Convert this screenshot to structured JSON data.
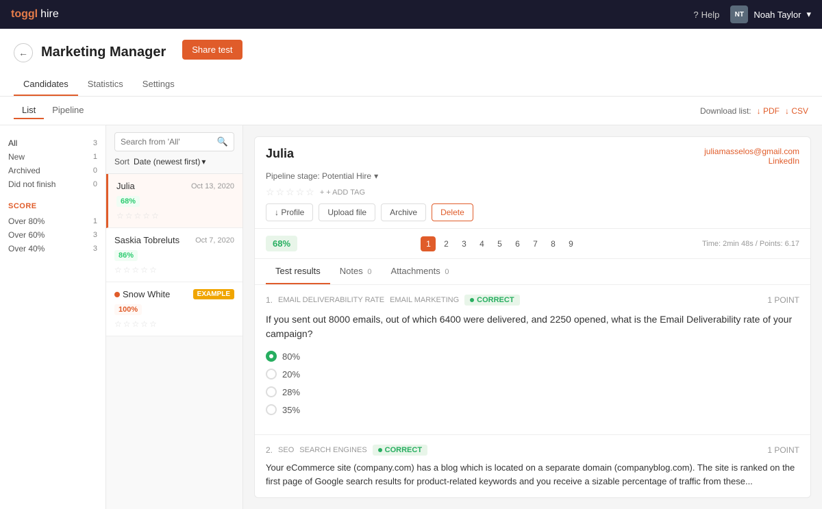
{
  "topnav": {
    "logo_toggl": "toggl",
    "logo_hire": "hire",
    "help_label": "Help",
    "user_initials": "NT",
    "user_name": "Noah Taylor",
    "chevron": "▾"
  },
  "page": {
    "back_icon": "←",
    "title": "Marketing Manager",
    "nav_items": [
      {
        "label": "Candidates",
        "active": true
      },
      {
        "label": "Statistics",
        "active": false
      },
      {
        "label": "Settings",
        "active": false
      }
    ],
    "share_test_label": "Share test"
  },
  "subheader": {
    "view_tabs": [
      {
        "label": "List",
        "active": true
      },
      {
        "label": "Pipeline",
        "active": false
      }
    ],
    "download_label": "Download list:",
    "pdf_label": "↓ PDF",
    "csv_label": "↓ CSV"
  },
  "left_sidebar": {
    "filters": [
      {
        "label": "All",
        "count": "3",
        "active": true
      },
      {
        "label": "New",
        "count": "1",
        "active": false
      },
      {
        "label": "Archived",
        "count": "0",
        "active": false
      },
      {
        "label": "Did not finish",
        "count": "0",
        "active": false
      }
    ],
    "score_section_title": "SCORE",
    "score_filters": [
      {
        "label": "Over 80%",
        "count": "1"
      },
      {
        "label": "Over 60%",
        "count": "3"
      },
      {
        "label": "Over 40%",
        "count": "3"
      }
    ]
  },
  "candidate_list": {
    "search_placeholder": "Search from 'All'",
    "search_icon": "🔍",
    "sort_label": "Sort",
    "sort_value": "Date (newest first)",
    "sort_chevron": "▾",
    "candidates": [
      {
        "name": "Julia",
        "date": "Oct 13, 2020",
        "score": "68%",
        "score_class": "green",
        "active": true,
        "has_dot": false,
        "example": false
      },
      {
        "name": "Saskia Tobreluts",
        "date": "Oct 7, 2020",
        "score": "86%",
        "score_class": "green",
        "active": false,
        "has_dot": false,
        "example": false
      },
      {
        "name": "Snow White",
        "date": "",
        "score": "100%",
        "score_class": "orange",
        "active": false,
        "has_dot": true,
        "example": true,
        "example_label": "EXAMPLE"
      }
    ]
  },
  "detail": {
    "candidate_name": "Julia",
    "pipeline_label": "Pipeline stage: Potential Hire",
    "pipeline_chevron": "▾",
    "email": "juliamasselos@gmail.com",
    "linkedin": "LinkedIn",
    "stars": [
      "☆",
      "☆",
      "☆",
      "☆",
      "☆"
    ],
    "add_tag_label": "+ ADD TAG",
    "actions": [
      {
        "label": "↓ Profile",
        "class": ""
      },
      {
        "label": "Upload file",
        "class": ""
      },
      {
        "label": "Archive",
        "class": "archive"
      },
      {
        "label": "Delete",
        "class": "delete"
      }
    ],
    "score_badge": "68%",
    "page_numbers": [
      "1",
      "2",
      "3",
      "4",
      "5",
      "6",
      "7",
      "8",
      "9"
    ],
    "active_page": "1",
    "time_points": "Time: 2min 48s / Points: 6.17",
    "tabs": [
      {
        "label": "Test results",
        "count": "",
        "active": true
      },
      {
        "label": "Notes",
        "count": "0",
        "active": false
      },
      {
        "label": "Attachments",
        "count": "0",
        "active": false
      }
    ],
    "question1": {
      "num": "1.",
      "topic": "EMAIL DELIVERABILITY RATE",
      "category": "EMAIL MARKETING",
      "correct_label": "CORRECT",
      "points_label": "1 POINT",
      "question_text": "If you sent out 8000 emails, out of which 6400 were delivered, and 2250 opened, what is the Email Deliverability rate of your campaign?",
      "options": [
        {
          "label": "80%",
          "selected": true
        },
        {
          "label": "20%",
          "selected": false
        },
        {
          "label": "28%",
          "selected": false
        },
        {
          "label": "35%",
          "selected": false
        }
      ]
    },
    "question2": {
      "num": "2.",
      "topic": "SEO",
      "category": "SEARCH ENGINES",
      "correct_label": "CORRECT",
      "points_label": "1 POINT",
      "question_text": "Your eCommerce site (company.com) has a blog which is located on a separate domain (companyblog.com). The site is ranked on the first page of Google search results for product-related keywords and you receive a sizable percentage of traffic from these..."
    }
  }
}
